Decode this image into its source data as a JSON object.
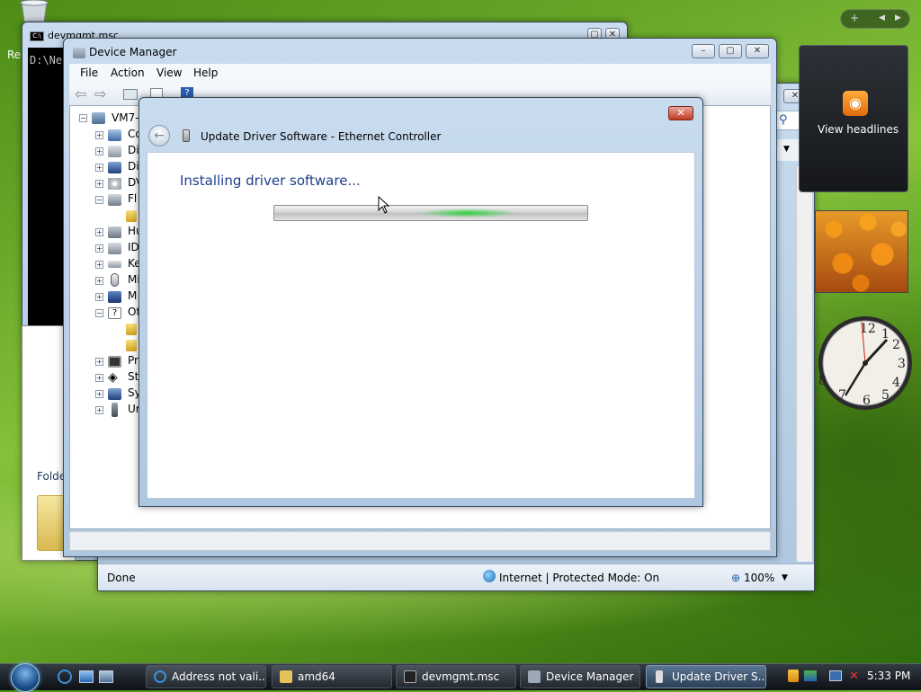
{
  "desktop": {
    "left_label": "Re"
  },
  "cmd_window": {
    "title": "devmgmt.msc",
    "console_text": "D:\\Ne",
    "icon_text": "C:\\"
  },
  "explorer_window": {
    "folder_label": "Folde"
  },
  "ie_window": {
    "status_done": "Done",
    "status_zone": "Internet | Protected Mode: On",
    "zoom": "100%"
  },
  "device_manager": {
    "title": "Device Manager",
    "menu": [
      "File",
      "Action",
      "View",
      "Help"
    ],
    "tree": {
      "root": "VM7-",
      "items": [
        "Co",
        "Di",
        "Di",
        "DV",
        "Fl",
        "",
        "Hu",
        "ID",
        "Ke",
        "Mi",
        "M",
        "Ot",
        "",
        "",
        "Pr",
        "St",
        "Sy",
        "Ur"
      ]
    }
  },
  "dialog": {
    "title": "Update Driver Software - Ethernet Controller",
    "heading": "Installing driver software...",
    "close_glyph": "✕",
    "progress_state": "indeterminate"
  },
  "sidebar": {
    "add_glyph": "+",
    "prev_glyph": "◀",
    "next_glyph": "▶",
    "feeds_label": "View headlines",
    "clock_numbers": [
      "12",
      "1",
      "2",
      "3",
      "4",
      "5",
      "6",
      "7",
      "8"
    ]
  },
  "taskbar": {
    "buttons": [
      {
        "label": "Address not vali...",
        "icon": "ie-icon",
        "color": "#3b8fd8"
      },
      {
        "label": "amd64",
        "icon": "folder-icon",
        "color": "#e4c35a"
      },
      {
        "label": "devmgmt.msc",
        "icon": "cmd-icon",
        "color": "#222222"
      },
      {
        "label": "Device Manager",
        "icon": "device-manager-icon",
        "color": "#9aa8b8"
      },
      {
        "label": "Update Driver S...",
        "icon": "driver-icon",
        "color": "#dddddd"
      }
    ],
    "clock": "5:33 PM"
  },
  "colors": {
    "dialog_heading": "#1e3e8a",
    "progress_glow": "#2fd23c",
    "taskbar": "#0d1014"
  }
}
